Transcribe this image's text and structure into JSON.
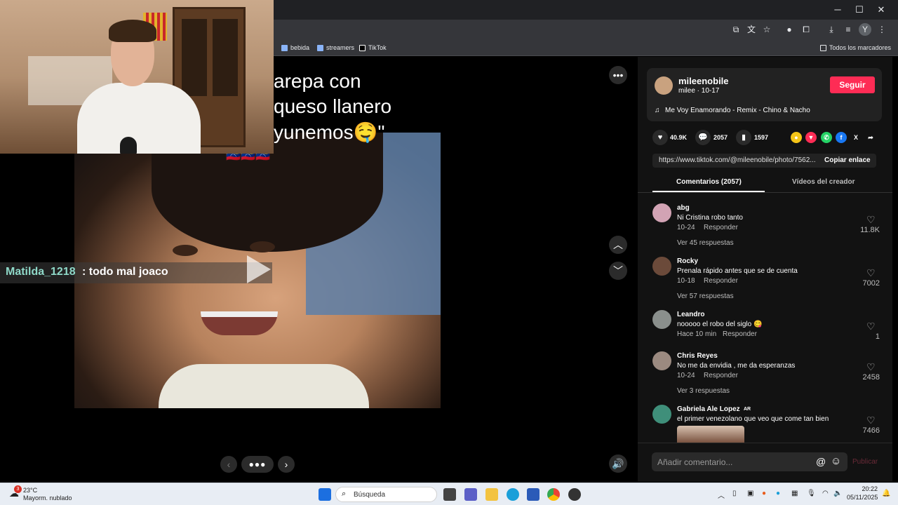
{
  "browser": {
    "bookmarks": [
      "bebida",
      "streamers",
      "TikTok"
    ],
    "all_bookmarks": "Todos los marcadores",
    "profile_letter": "Y"
  },
  "player": {
    "caption_lines": [
      "arepa con",
      "queso llanero",
      "yunemos🤤\""
    ],
    "flags": "🇻🇪🇻🇪🇻🇪",
    "chat_user": "Matilda_1218",
    "chat_message": ": todo mal joaco"
  },
  "panel": {
    "username": "mileenobile",
    "subline": "milee · 10-17",
    "follow": "Seguir",
    "music": "Me Voy Enamorando - Remix - Chino & Nacho",
    "likes": "40.9K",
    "comments": "2057",
    "saves": "1597",
    "link": "https://www.tiktok.com/@mileenobile/photo/7562...",
    "copy_link": "Copiar enlace",
    "tab_comments": "Comentarios (2057)",
    "tab_videos": "Vídeos del creador",
    "comment_placeholder": "Añadir comentario...",
    "publish": "Publicar",
    "comments_list": [
      {
        "user": "abg",
        "text": "Ni Cristina robo tanto",
        "date": "10-24",
        "reply": "Responder",
        "likes": "11.8K",
        "more": "Ver 45 respuestas"
      },
      {
        "user": "Rocky",
        "text": "Prenala rápido antes que se de cuenta",
        "date": "10-18",
        "reply": "Responder",
        "likes": "7002",
        "more": "Ver 57 respuestas"
      },
      {
        "user": "Leandro",
        "text": "nooooo el robo del siglo 😋",
        "date": "Hace 10 min",
        "reply": "Responder",
        "likes": "1",
        "more": ""
      },
      {
        "user": "Chris Reyes",
        "text": "No me da envidia , me da esperanzas",
        "date": "10-24",
        "reply": "Responder",
        "likes": "2458",
        "more": "Ver 3 respuestas"
      },
      {
        "user": "Gabriela Ale Lopez",
        "badge": "AR",
        "text": "el primer venezolano que veo que come tan bien",
        "date": "",
        "reply": "",
        "likes": "7466",
        "more": ""
      }
    ]
  },
  "taskbar": {
    "weather_temp": "23°C",
    "weather_desc": "Mayorm. nublado",
    "weather_badge": "3",
    "search": "Búsqueda",
    "time": "20:22",
    "date": "05/11/2025"
  },
  "colors": {
    "accent": "#fe2c55",
    "panel": "#121212"
  }
}
